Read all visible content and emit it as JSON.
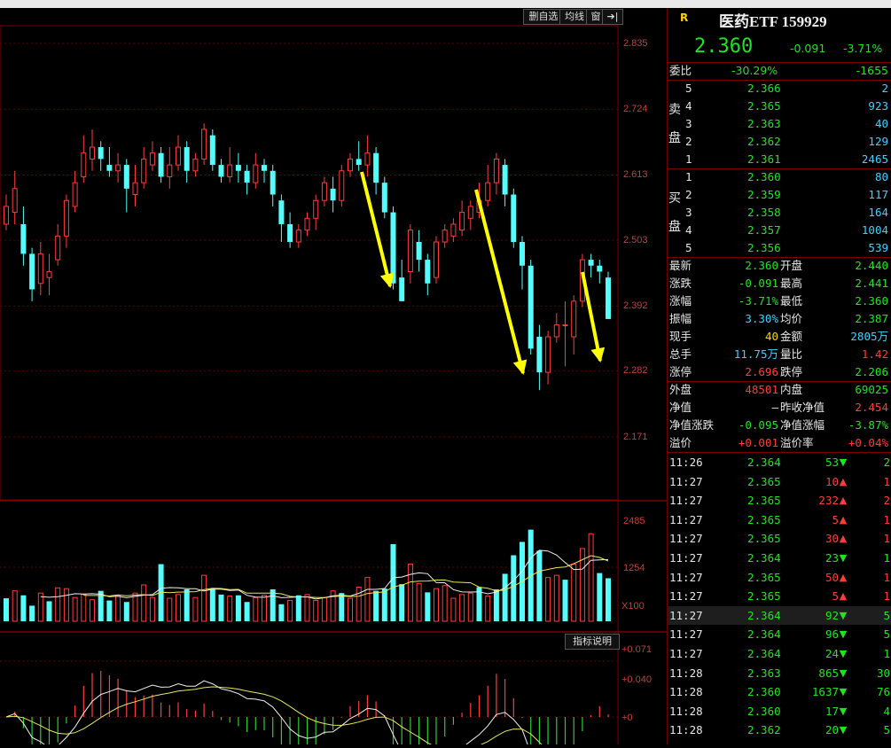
{
  "toolbar": {
    "btn1": "删自选",
    "btn2": "均线",
    "btn3": "窗",
    "btn4": "➔|"
  },
  "price_axis": [
    "2.835",
    "2.724",
    "2.613",
    "2.503",
    "2.392",
    "2.282",
    "2.171"
  ],
  "vol_axis": [
    "2485",
    "1254",
    "X100"
  ],
  "macd": {
    "label": "指标说明",
    "ticks": [
      "+0.071",
      "+0.040",
      "+0"
    ]
  },
  "header": {
    "r_mark": "R",
    "title": "医药ETF 159929",
    "price": "2.360",
    "change": "-0.091",
    "pct": "-3.71%"
  },
  "weibi": {
    "label": "委比",
    "pct": "-30.29%",
    "diff": "-1655"
  },
  "sell": {
    "label_chars": [
      "卖",
      "盘"
    ],
    "rows": [
      {
        "lvl": "5",
        "price": "2.366",
        "vol": "2"
      },
      {
        "lvl": "4",
        "price": "2.365",
        "vol": "923"
      },
      {
        "lvl": "3",
        "price": "2.363",
        "vol": "40"
      },
      {
        "lvl": "2",
        "price": "2.362",
        "vol": "129"
      },
      {
        "lvl": "1",
        "price": "2.361",
        "vol": "2465"
      }
    ]
  },
  "buy": {
    "label_chars": [
      "买",
      "盘"
    ],
    "rows": [
      {
        "lvl": "1",
        "price": "2.360",
        "vol": "80"
      },
      {
        "lvl": "2",
        "price": "2.359",
        "vol": "117"
      },
      {
        "lvl": "3",
        "price": "2.358",
        "vol": "164"
      },
      {
        "lvl": "4",
        "price": "2.357",
        "vol": "1004"
      },
      {
        "lvl": "5",
        "price": "2.356",
        "vol": "539"
      }
    ]
  },
  "stats": [
    {
      "l1": "最新",
      "v1": "2.360",
      "c1": "green",
      "l2": "开盘",
      "v2": "2.440",
      "c2": "green"
    },
    {
      "l1": "涨跌",
      "v1": "-0.091",
      "c1": "green",
      "l2": "最高",
      "v2": "2.441",
      "c2": "green"
    },
    {
      "l1": "涨幅",
      "v1": "-3.71%",
      "c1": "green",
      "l2": "最低",
      "v2": "2.360",
      "c2": "green"
    },
    {
      "l1": "振幅",
      "v1": "3.30%",
      "c1": "cyan",
      "l2": "均价",
      "v2": "2.387",
      "c2": "green"
    },
    {
      "l1": "现手",
      "v1": "40",
      "c1": "yellow",
      "l2": "金额",
      "v2": "2805万",
      "c2": "cyan"
    },
    {
      "l1": "总手",
      "v1": "11.75万",
      "c1": "cyan",
      "l2": "量比",
      "v2": "1.42",
      "c2": "red"
    },
    {
      "l1": "涨停",
      "v1": "2.696",
      "c1": "red",
      "l2": "跌停",
      "v2": "2.206",
      "c2": "green"
    }
  ],
  "stats2": [
    {
      "l1": "外盘",
      "v1": "48501",
      "c1": "red",
      "l2": "内盘",
      "v2": "69025",
      "c2": "green"
    },
    {
      "l1": "净值",
      "v1": "—",
      "c1": "white",
      "l2": "昨收净值",
      "v2": "2.454",
      "c2": "red"
    },
    {
      "l1": "净值涨跌",
      "v1": "-0.095",
      "c1": "green",
      "l2": "净值涨幅",
      "v2": "-3.87%",
      "c2": "green"
    },
    {
      "l1": "溢价",
      "v1": "+0.001",
      "c1": "red",
      "l2": "溢价率",
      "v2": "+0.04%",
      "c2": "red"
    }
  ],
  "ticks": [
    {
      "time": "11:26",
      "price": "2.364",
      "vol": "53",
      "dir": "down",
      "n": "2"
    },
    {
      "time": "11:27",
      "price": "2.365",
      "vol": "10",
      "dir": "up",
      "n": "1"
    },
    {
      "time": "11:27",
      "price": "2.365",
      "vol": "232",
      "dir": "up",
      "n": "2"
    },
    {
      "time": "11:27",
      "price": "2.365",
      "vol": "5",
      "dir": "up",
      "n": "1"
    },
    {
      "time": "11:27",
      "price": "2.365",
      "vol": "30",
      "dir": "up",
      "n": "1"
    },
    {
      "time": "11:27",
      "price": "2.364",
      "vol": "23",
      "dir": "down",
      "n": "1"
    },
    {
      "time": "11:27",
      "price": "2.365",
      "vol": "50",
      "dir": "up",
      "n": "1"
    },
    {
      "time": "11:27",
      "price": "2.365",
      "vol": "5",
      "dir": "up",
      "n": "1"
    },
    {
      "time": "11:27",
      "price": "2.364",
      "vol": "92",
      "dir": "down",
      "n": "5"
    },
    {
      "time": "11:27",
      "price": "2.364",
      "vol": "96",
      "dir": "down",
      "n": "5"
    },
    {
      "time": "11:27",
      "price": "2.364",
      "vol": "24",
      "dir": "down",
      "n": "1"
    },
    {
      "time": "11:28",
      "price": "2.363",
      "vol": "865",
      "dir": "down",
      "n": "30"
    },
    {
      "time": "11:28",
      "price": "2.360",
      "vol": "1637",
      "dir": "down",
      "n": "76"
    },
    {
      "time": "11:28",
      "price": "2.360",
      "vol": "17",
      "dir": "down",
      "n": "4"
    },
    {
      "time": "11:28",
      "price": "2.362",
      "vol": "20",
      "dir": "down",
      "n": "5"
    }
  ],
  "colors": {
    "up": "#ff3c3c",
    "down": "#1ee61e",
    "cyan": "#54fcfc",
    "grid": "#7a0000"
  },
  "chart_data": {
    "type": "candlestick",
    "y_ticks": [
      2.835,
      2.724,
      2.613,
      2.503,
      2.392,
      2.282,
      2.171
    ],
    "volume_ticks": [
      2485,
      1254
    ],
    "candles": [
      [
        2.53,
        2.56,
        2.58,
        2.52
      ],
      [
        2.55,
        2.59,
        2.62,
        2.53
      ],
      [
        2.53,
        2.48,
        2.56,
        2.46
      ],
      [
        2.48,
        2.42,
        2.49,
        2.4
      ],
      [
        2.43,
        2.48,
        2.5,
        2.41
      ],
      [
        2.44,
        2.45,
        2.48,
        2.41
      ],
      [
        2.47,
        2.51,
        2.53,
        2.46
      ],
      [
        2.51,
        2.57,
        2.58,
        2.49
      ],
      [
        2.56,
        2.6,
        2.62,
        2.55
      ],
      [
        2.61,
        2.65,
        2.68,
        2.6
      ],
      [
        2.64,
        2.66,
        2.69,
        2.62
      ],
      [
        2.66,
        2.64,
        2.67,
        2.62
      ],
      [
        2.63,
        2.62,
        2.66,
        2.61
      ],
      [
        2.62,
        2.63,
        2.65,
        2.6
      ],
      [
        2.63,
        2.59,
        2.64,
        2.55
      ],
      [
        2.58,
        2.6,
        2.63,
        2.56
      ],
      [
        2.6,
        2.64,
        2.66,
        2.59
      ],
      [
        2.63,
        2.65,
        2.67,
        2.62
      ],
      [
        2.65,
        2.61,
        2.66,
        2.6
      ],
      [
        2.61,
        2.63,
        2.66,
        2.59
      ],
      [
        2.63,
        2.66,
        2.68,
        2.62
      ],
      [
        2.66,
        2.62,
        2.67,
        2.6
      ],
      [
        2.62,
        2.64,
        2.65,
        2.61
      ],
      [
        2.64,
        2.69,
        2.7,
        2.63
      ],
      [
        2.68,
        2.63,
        2.69,
        2.62
      ],
      [
        2.63,
        2.61,
        2.64,
        2.6
      ],
      [
        2.61,
        2.63,
        2.66,
        2.6
      ],
      [
        2.63,
        2.62,
        2.65,
        2.6
      ],
      [
        2.62,
        2.6,
        2.63,
        2.58
      ],
      [
        2.6,
        2.63,
        2.65,
        2.59
      ],
      [
        2.63,
        2.62,
        2.64,
        2.6
      ],
      [
        2.62,
        2.58,
        2.63,
        2.56
      ],
      [
        2.57,
        2.53,
        2.58,
        2.5
      ],
      [
        2.53,
        2.5,
        2.55,
        2.49
      ],
      [
        2.5,
        2.52,
        2.53,
        2.49
      ],
      [
        2.52,
        2.54,
        2.55,
        2.51
      ],
      [
        2.54,
        2.57,
        2.58,
        2.52
      ],
      [
        2.57,
        2.6,
        2.61,
        2.56
      ],
      [
        2.59,
        2.57,
        2.61,
        2.55
      ],
      [
        2.57,
        2.62,
        2.63,
        2.56
      ],
      [
        2.62,
        2.64,
        2.65,
        2.61
      ],
      [
        2.64,
        2.63,
        2.67,
        2.62
      ],
      [
        2.63,
        2.65,
        2.68,
        2.61
      ],
      [
        2.65,
        2.6,
        2.66,
        2.58
      ],
      [
        2.6,
        2.55,
        2.61,
        2.54
      ],
      [
        2.55,
        2.43,
        2.56,
        2.42
      ],
      [
        2.44,
        2.4,
        2.47,
        2.4
      ],
      [
        2.45,
        2.52,
        2.53,
        2.43
      ],
      [
        2.5,
        2.47,
        2.52,
        2.45
      ],
      [
        2.47,
        2.43,
        2.48,
        2.41
      ],
      [
        2.44,
        2.5,
        2.51,
        2.43
      ],
      [
        2.5,
        2.52,
        2.53,
        2.49
      ],
      [
        2.51,
        2.53,
        2.54,
        2.5
      ],
      [
        2.52,
        2.55,
        2.57,
        2.51
      ],
      [
        2.54,
        2.56,
        2.57,
        2.52
      ],
      [
        2.55,
        2.57,
        2.6,
        2.54
      ],
      [
        2.57,
        2.6,
        2.63,
        2.56
      ],
      [
        2.6,
        2.64,
        2.65,
        2.58
      ],
      [
        2.63,
        2.58,
        2.64,
        2.56
      ],
      [
        2.58,
        2.5,
        2.59,
        2.49
      ],
      [
        2.5,
        2.46,
        2.51,
        2.42
      ],
      [
        2.46,
        2.32,
        2.47,
        2.31
      ],
      [
        2.34,
        2.28,
        2.36,
        2.25
      ],
      [
        2.28,
        2.34,
        2.35,
        2.26
      ],
      [
        2.34,
        2.36,
        2.38,
        2.33
      ],
      [
        2.36,
        2.36,
        2.4,
        2.29
      ],
      [
        2.34,
        2.4,
        2.41,
        2.31
      ],
      [
        2.4,
        2.47,
        2.48,
        2.39
      ],
      [
        2.47,
        2.46,
        2.48,
        2.44
      ],
      [
        2.46,
        2.45,
        2.47,
        2.43
      ],
      [
        2.44,
        2.37,
        2.45,
        2.37
      ]
    ],
    "volumes": [
      [
        620,
        "d"
      ],
      [
        820,
        "u"
      ],
      [
        700,
        "d"
      ],
      [
        420,
        "d"
      ],
      [
        760,
        "u"
      ],
      [
        540,
        "d"
      ],
      [
        900,
        "u"
      ],
      [
        880,
        "u"
      ],
      [
        640,
        "u"
      ],
      [
        720,
        "u"
      ],
      [
        580,
        "u"
      ],
      [
        820,
        "d"
      ],
      [
        560,
        "d"
      ],
      [
        700,
        "u"
      ],
      [
        520,
        "d"
      ],
      [
        760,
        "u"
      ],
      [
        980,
        "u"
      ],
      [
        640,
        "u"
      ],
      [
        1540,
        "d"
      ],
      [
        620,
        "u"
      ],
      [
        720,
        "u"
      ],
      [
        860,
        "d"
      ],
      [
        640,
        "u"
      ],
      [
        1240,
        "u"
      ],
      [
        880,
        "d"
      ],
      [
        720,
        "d"
      ],
      [
        680,
        "u"
      ],
      [
        700,
        "d"
      ],
      [
        520,
        "d"
      ],
      [
        640,
        "u"
      ],
      [
        700,
        "u"
      ],
      [
        860,
        "d"
      ],
      [
        460,
        "d"
      ],
      [
        560,
        "u"
      ],
      [
        700,
        "d"
      ],
      [
        720,
        "u"
      ],
      [
        560,
        "u"
      ],
      [
        640,
        "u"
      ],
      [
        820,
        "u"
      ],
      [
        760,
        "d"
      ],
      [
        620,
        "u"
      ],
      [
        920,
        "u"
      ],
      [
        1180,
        "u"
      ],
      [
        820,
        "d"
      ],
      [
        880,
        "d"
      ],
      [
        2080,
        "d"
      ],
      [
        1000,
        "d"
      ],
      [
        1540,
        "u"
      ],
      [
        1020,
        "u"
      ],
      [
        780,
        "d"
      ],
      [
        880,
        "u"
      ],
      [
        960,
        "u"
      ],
      [
        620,
        "u"
      ],
      [
        720,
        "u"
      ],
      [
        760,
        "u"
      ],
      [
        920,
        "d"
      ],
      [
        680,
        "u"
      ],
      [
        860,
        "d"
      ],
      [
        1280,
        "d"
      ],
      [
        1780,
        "d"
      ],
      [
        2140,
        "d"
      ],
      [
        2470,
        "d"
      ],
      [
        1900,
        "d"
      ],
      [
        1180,
        "u"
      ],
      [
        1240,
        "u"
      ],
      [
        1120,
        "d"
      ],
      [
        1540,
        "u"
      ],
      [
        1960,
        "u"
      ],
      [
        2360,
        "u"
      ],
      [
        1300,
        "d"
      ],
      [
        1160,
        "d"
      ]
    ]
  }
}
